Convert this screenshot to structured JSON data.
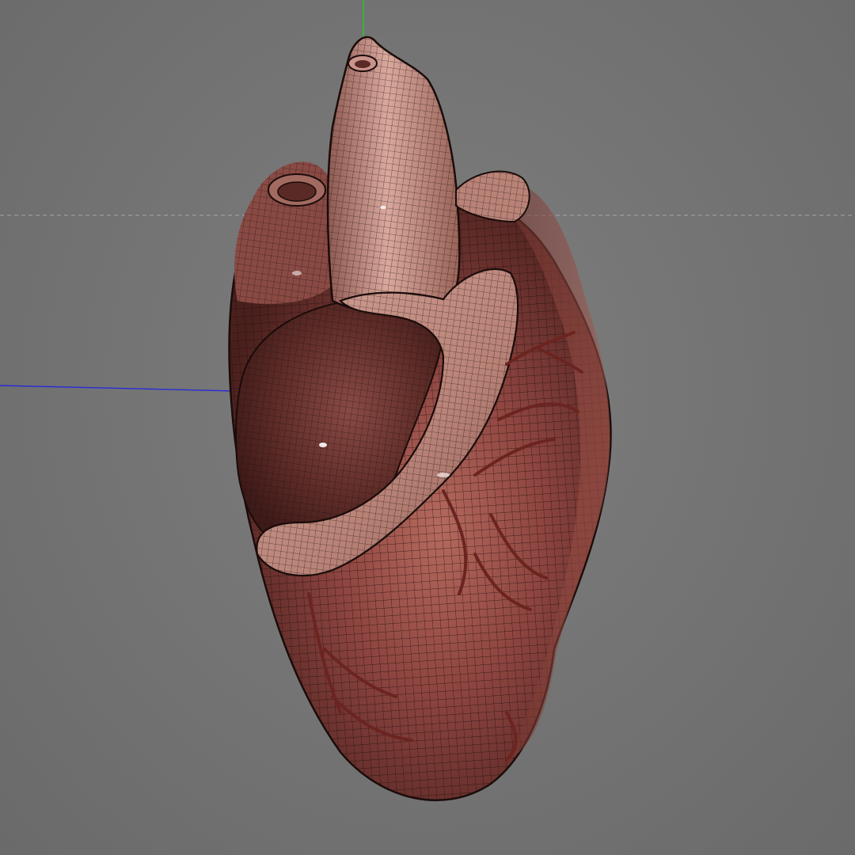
{
  "viewport": {
    "background_color": "#757575",
    "horizon_line_color": "#a8a8a8",
    "axes": {
      "x_axis_color": "#2a2ad8",
      "y_axis_color": "#22cc22"
    }
  },
  "model": {
    "subject": "heart-mesh",
    "display_mode": "shaded-wireframe",
    "colors": {
      "flesh_dark": "#5a2a26",
      "flesh_mid": "#8e4a42",
      "flesh_light": "#c9948a",
      "vessel": "#6b2420",
      "wire": "#1e0f0d"
    }
  }
}
